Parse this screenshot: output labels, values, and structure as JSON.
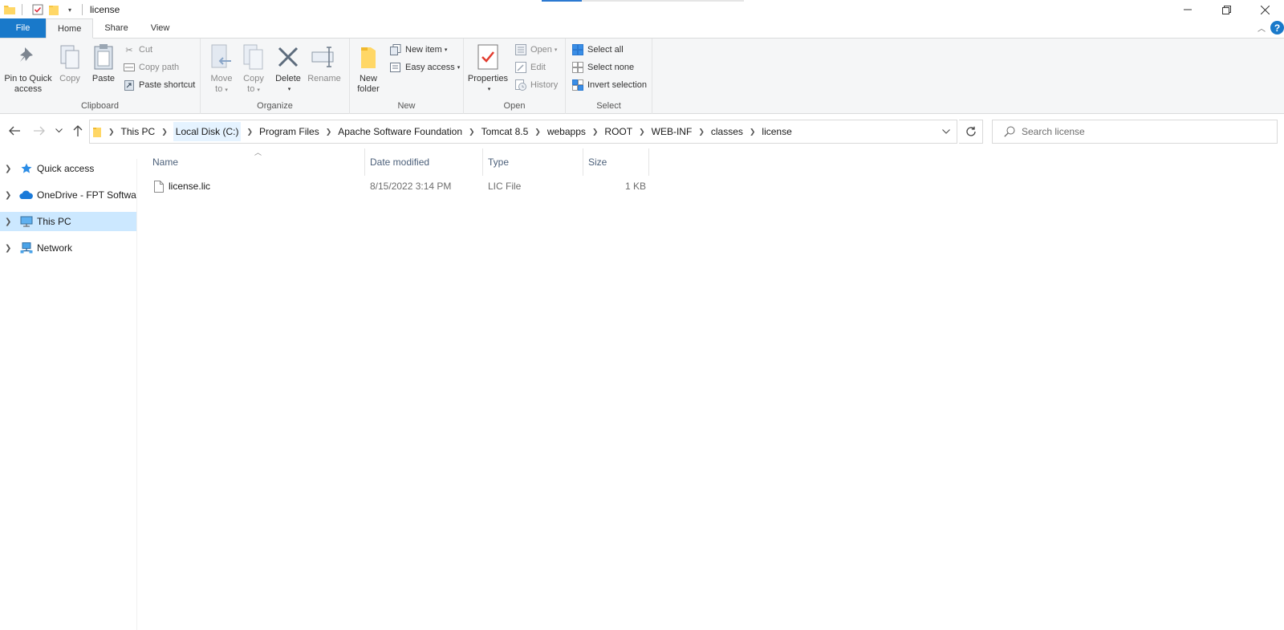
{
  "window": {
    "title": "license",
    "controls": {
      "minimize": "—",
      "restore": "❐",
      "close": "✕"
    }
  },
  "tabs": {
    "file": "File",
    "home": "Home",
    "share": "Share",
    "view": "View",
    "help": "?"
  },
  "ribbon": {
    "clipboard": {
      "label": "Clipboard",
      "pin_line1": "Pin to Quick",
      "pin_line2": "access",
      "copy": "Copy",
      "paste": "Paste",
      "cut": "Cut",
      "copy_path": "Copy path",
      "paste_shortcut": "Paste shortcut"
    },
    "organize": {
      "label": "Organize",
      "move_line1": "Move",
      "move_line2": "to",
      "copy_line1": "Copy",
      "copy_line2": "to",
      "delete": "Delete",
      "rename": "Rename"
    },
    "new": {
      "label": "New",
      "new_folder_line1": "New",
      "new_folder_line2": "folder",
      "new_item": "New item",
      "easy_access": "Easy access"
    },
    "open": {
      "label": "Open",
      "properties": "Properties",
      "open": "Open",
      "edit": "Edit",
      "history": "History"
    },
    "select": {
      "label": "Select",
      "select_all": "Select all",
      "select_none": "Select none",
      "invert": "Invert selection"
    }
  },
  "address": {
    "crumbs": [
      "This PC",
      "Local Disk (C:)",
      "Program Files",
      "Apache Software Foundation",
      "Tomcat 8.5",
      "webapps",
      "ROOT",
      "WEB-INF",
      "classes",
      "license"
    ]
  },
  "search": {
    "placeholder": "Search license"
  },
  "navpane": {
    "quick_access": "Quick access",
    "onedrive": "OneDrive - FPT Softwa",
    "this_pc": "This PC",
    "network": "Network"
  },
  "columns": {
    "name": "Name",
    "date": "Date modified",
    "type": "Type",
    "size": "Size"
  },
  "files": [
    {
      "name": "license.lic",
      "date": "8/15/2022 3:14 PM",
      "type": "LIC File",
      "size": "1 KB"
    }
  ],
  "colors": {
    "accent": "#1979ca",
    "selection": "#cce8ff",
    "ribbon_bg": "#f5f6f7"
  }
}
